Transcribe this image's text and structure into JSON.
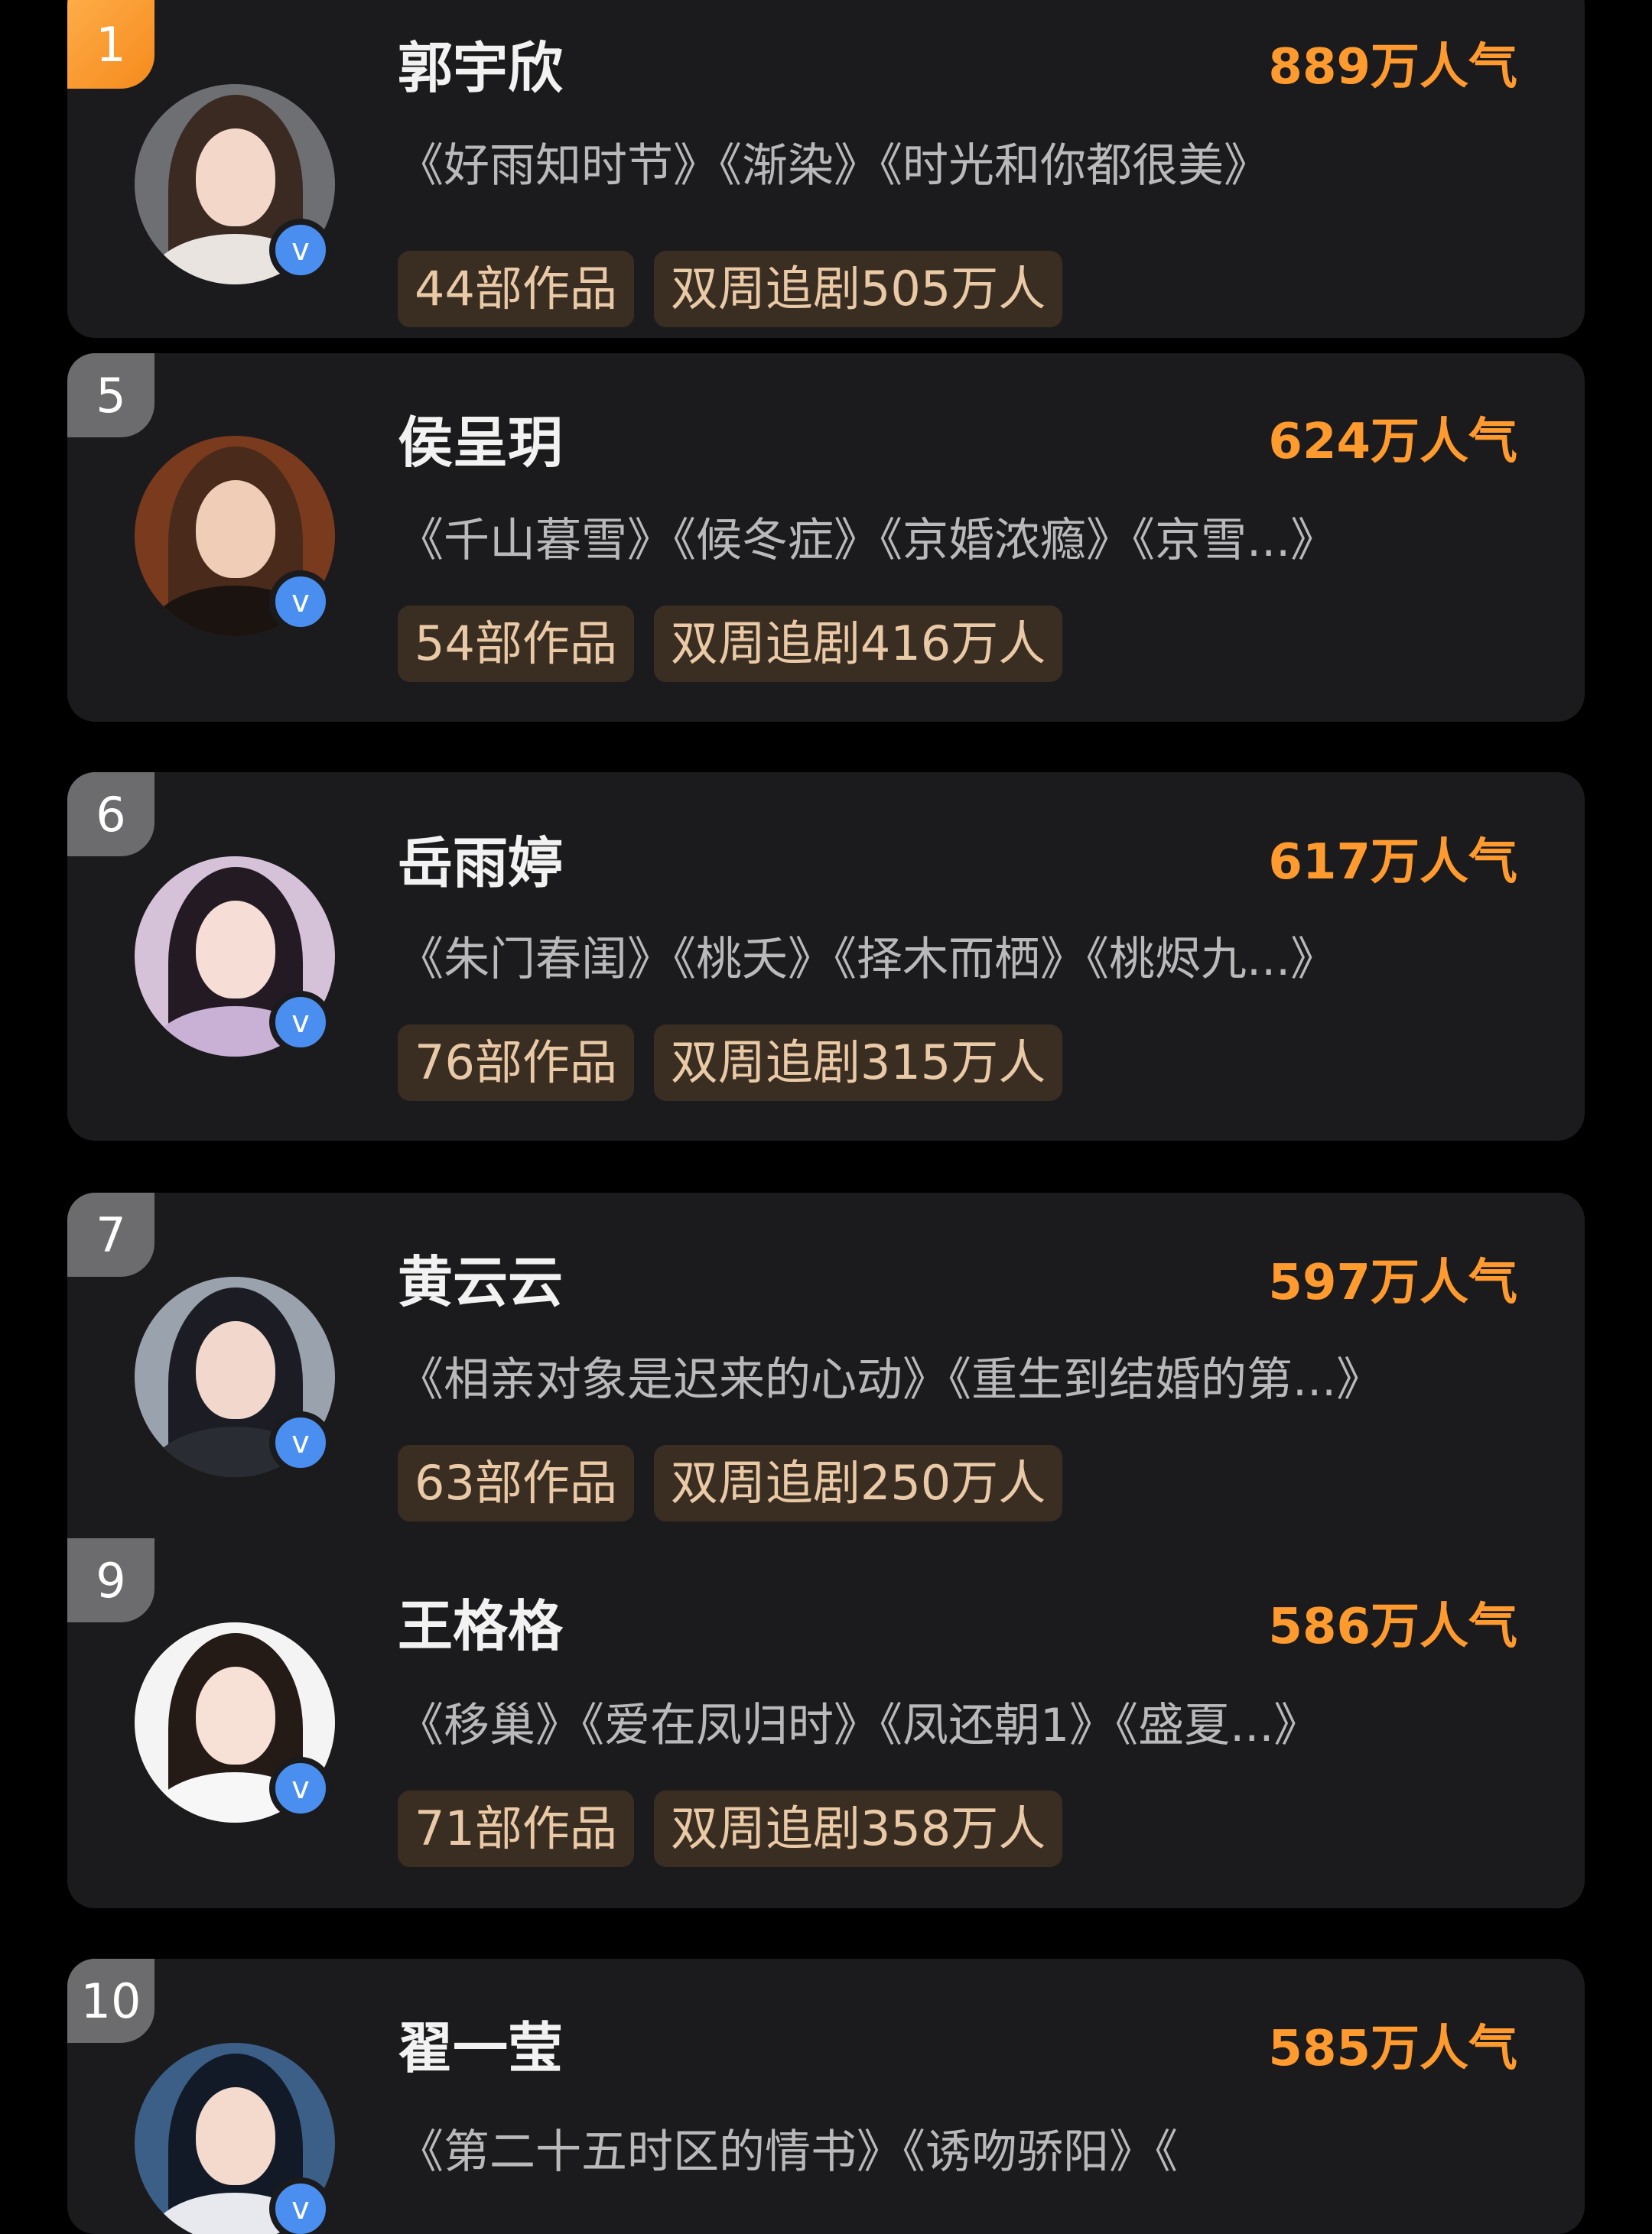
{
  "cards": [
    {
      "rank": "1",
      "name": "郭宇欣",
      "popularity": "889万人气",
      "works": "《好雨知时节》《渐染》《时光和你都很美》",
      "tag_works": "44部作品",
      "tag_viewers": "双周追剧505万人",
      "verified": "v"
    },
    {
      "rank": "5",
      "name": "侯呈玥",
      "popularity": "624万人气",
      "works": "《千山暮雪》《候冬症》《京婚浓瘾》《京雪...》",
      "tag_works": "54部作品",
      "tag_viewers": "双周追剧416万人",
      "verified": "v"
    },
    {
      "rank": "6",
      "name": "岳雨婷",
      "popularity": "617万人气",
      "works": "《朱门春闺》《桃夭》《择木而栖》《桃烬九...》",
      "tag_works": "76部作品",
      "tag_viewers": "双周追剧315万人",
      "verified": "v"
    },
    {
      "rank": "7",
      "name": "黄云云",
      "popularity": "597万人气",
      "works": "《相亲对象是迟来的心动》《重生到结婚的第...》",
      "tag_works": "63部作品",
      "tag_viewers": "双周追剧250万人",
      "verified": "v"
    },
    {
      "rank": "9",
      "name": "王格格",
      "popularity": "586万人气",
      "works": "《移巢》《爱在凤归时》《凤还朝1》《盛夏...》",
      "tag_works": "71部作品",
      "tag_viewers": "双周追剧358万人",
      "verified": "v"
    },
    {
      "rank": "10",
      "name": "翟一莹",
      "popularity": "585万人气",
      "works": "《第二十五时区的情书》《诱吻骄阳》《",
      "verified": "v"
    }
  ],
  "colors": {
    "accent": "#ff9a2e",
    "card_bg": "#1b1b1d",
    "tag_bg": "#3a2e22",
    "verified": "#4a8ff0"
  }
}
